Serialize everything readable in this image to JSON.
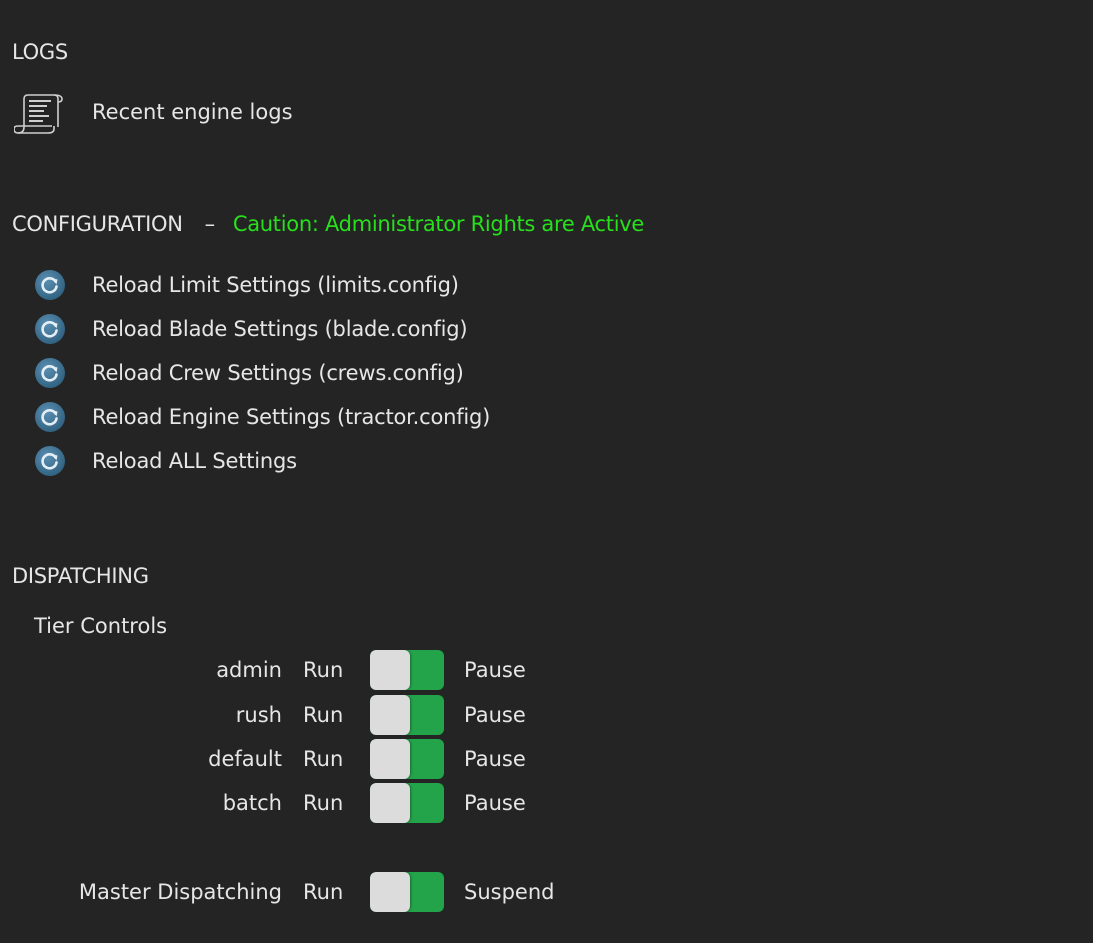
{
  "logs": {
    "heading": "LOGS",
    "item_label": "Recent engine logs"
  },
  "configuration": {
    "heading": "CONFIGURATION",
    "separator": "–",
    "caution": "Caution: Administrator Rights are Active",
    "reload_items": [
      {
        "label": "Reload Limit Settings (limits.config)"
      },
      {
        "label": "Reload Blade Settings (blade.config)"
      },
      {
        "label": "Reload Crew Settings (crews.config)"
      },
      {
        "label": "Reload Engine Settings (tractor.config)"
      },
      {
        "label": "Reload ALL Settings"
      }
    ]
  },
  "dispatching": {
    "heading": "DISPATCHING",
    "tier_controls_label": "Tier Controls",
    "tiers": [
      {
        "name": "admin",
        "run_label": "Run",
        "alt_label": "Pause"
      },
      {
        "name": "rush",
        "run_label": "Run",
        "alt_label": "Pause"
      },
      {
        "name": "default",
        "run_label": "Run",
        "alt_label": "Pause"
      },
      {
        "name": "batch",
        "run_label": "Run",
        "alt_label": "Pause"
      }
    ],
    "master": {
      "name": "Master Dispatching",
      "run_label": "Run",
      "alt_label": "Suspend"
    }
  },
  "colors": {
    "background": "#242424",
    "caution": "#27e01b",
    "toggle_on": "#23a34a",
    "toggle_knob": "#dcdcdc",
    "reload_icon": "#3d6f8f"
  }
}
